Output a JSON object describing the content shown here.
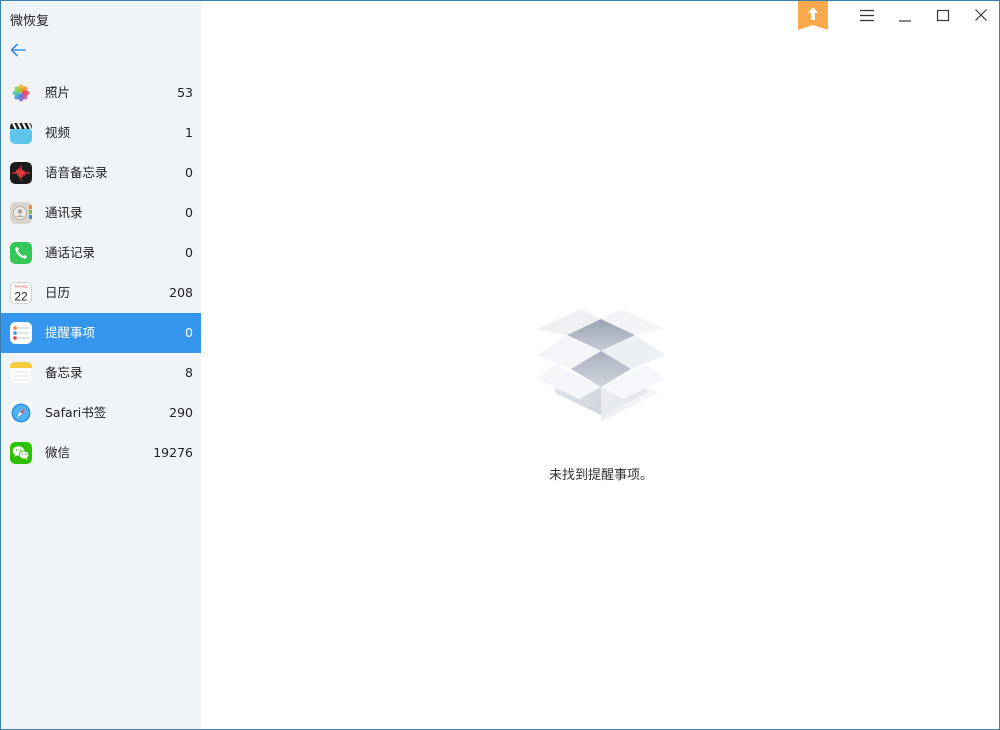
{
  "app": {
    "title": "微恢复"
  },
  "sidebar": {
    "items": [
      {
        "label": "照片",
        "count": "53",
        "icon": "photos-icon",
        "active": false
      },
      {
        "label": "视频",
        "count": "1",
        "icon": "video-clapper-icon",
        "active": false
      },
      {
        "label": "语音备忘录",
        "count": "0",
        "icon": "voice-memo-icon",
        "active": false
      },
      {
        "label": "通讯录",
        "count": "0",
        "icon": "contacts-icon",
        "active": false
      },
      {
        "label": "通话记录",
        "count": "0",
        "icon": "phone-icon",
        "active": false
      },
      {
        "label": "日历",
        "count": "208",
        "icon": "calendar-icon",
        "active": false
      },
      {
        "label": "提醒事项",
        "count": "0",
        "icon": "reminders-icon",
        "active": true
      },
      {
        "label": "备忘录",
        "count": "8",
        "icon": "notes-icon",
        "active": false
      },
      {
        "label": "Safari书签",
        "count": "290",
        "icon": "safari-icon",
        "active": false
      },
      {
        "label": "微信",
        "count": "19276",
        "icon": "wechat-icon",
        "active": false
      }
    ],
    "calendar_day": "22",
    "calendar_weekday": "Monday"
  },
  "main": {
    "empty_message": "未找到提醒事项。"
  },
  "colors": {
    "accent": "#3596ee",
    "sidebar_bg": "#f0f4f8",
    "upload_badge": "#f7a94b"
  }
}
